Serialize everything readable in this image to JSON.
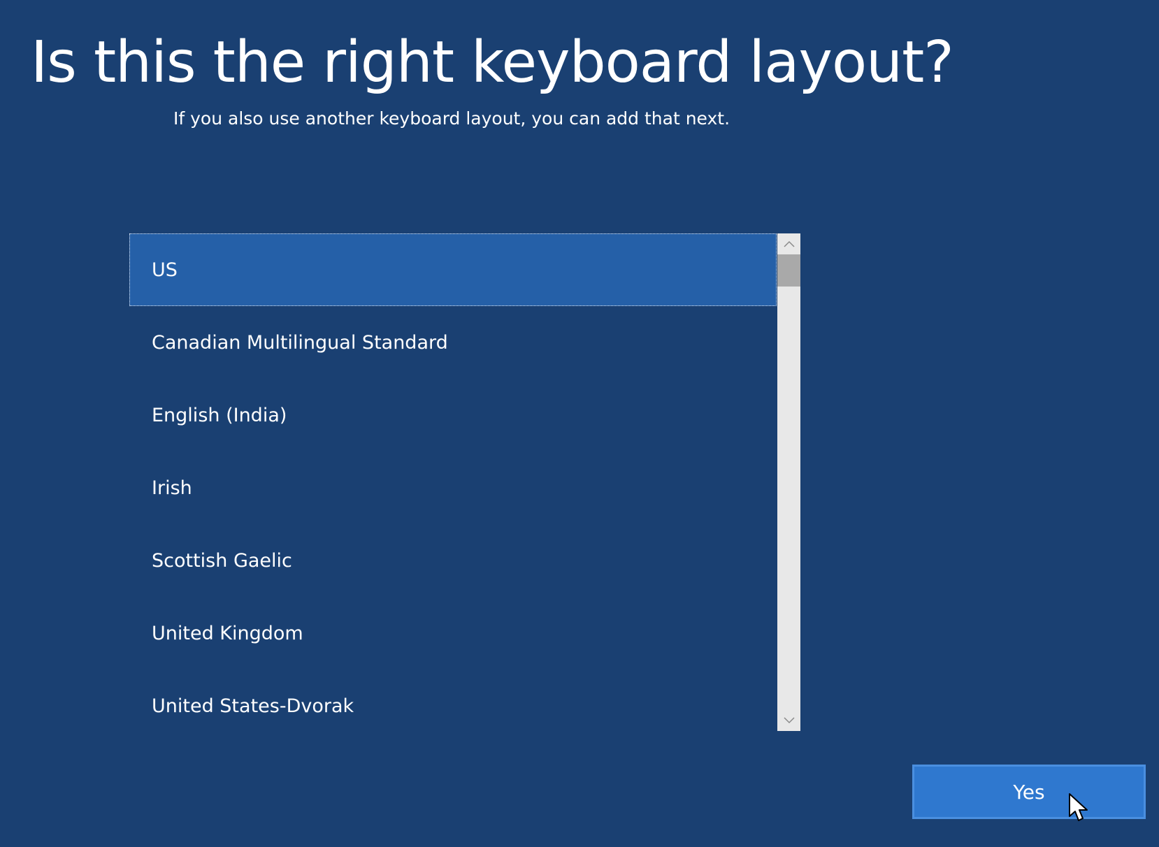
{
  "page": {
    "title": "Is this the right keyboard layout?",
    "subtitle": "If you also use another keyboard layout, you can add that next."
  },
  "layouts": {
    "items": [
      {
        "label": "US",
        "selected": true
      },
      {
        "label": "Canadian Multilingual Standard",
        "selected": false
      },
      {
        "label": "English (India)",
        "selected": false
      },
      {
        "label": "Irish",
        "selected": false
      },
      {
        "label": "Scottish Gaelic",
        "selected": false
      },
      {
        "label": "United Kingdom",
        "selected": false
      },
      {
        "label": "United States-Dvorak",
        "selected": false
      }
    ]
  },
  "footer": {
    "yes_label": "Yes"
  },
  "colors": {
    "background": "#1a4072",
    "selected_item": "#2560a8",
    "primary_button": "#2f78cf",
    "scrollbar_track": "#e8e8e8",
    "scrollbar_thumb": "#a9a9a9"
  },
  "icons": {
    "scroll_up": "chevron-up-icon",
    "scroll_down": "chevron-down-icon",
    "pointer": "mouse-pointer-icon"
  }
}
